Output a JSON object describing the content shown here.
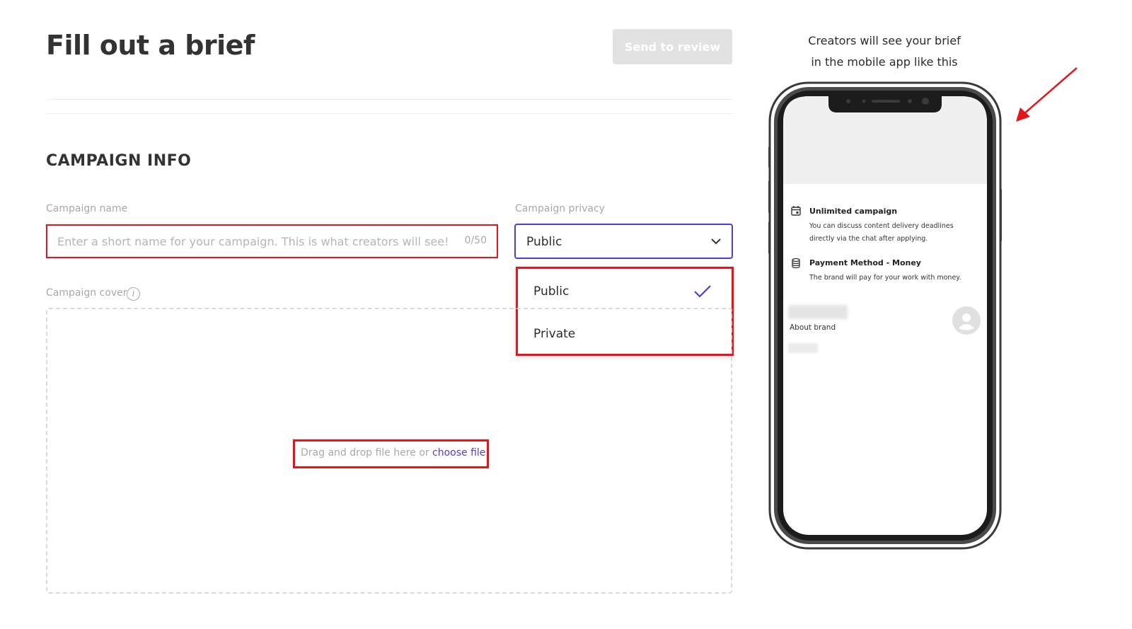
{
  "header": {
    "title": "Fill out a brief",
    "send_button": "Send to review"
  },
  "section": {
    "title": "CAMPAIGN INFO"
  },
  "campaign_name": {
    "label": "Campaign name",
    "placeholder": "Enter a short name for your campaign. This is what creators will see!",
    "value": "",
    "counter": "0/50"
  },
  "campaign_privacy": {
    "label": "Campaign privacy",
    "selected": "Public",
    "options": [
      "Public",
      "Private"
    ]
  },
  "campaign_cover": {
    "label": "Campaign cover",
    "drop_text": "Drag and drop file here or",
    "choose_link": "choose file"
  },
  "preview": {
    "caption_line1": "Creators will see your brief",
    "caption_line2": "in the mobile app like this",
    "unlimited_title": "Unlimited campaign",
    "unlimited_sub1": "You can discuss content delivery deadlines",
    "unlimited_sub2": "directly via the chat after applying.",
    "payment_title": "Payment Method - Money",
    "payment_sub": "The brand will pay for your work with money.",
    "about_brand": "About brand"
  },
  "colors": {
    "accent": "#4b3fd6",
    "highlight": "#e4161b",
    "disabled_button": "#e2e2e2"
  },
  "icons": {
    "chevron": "chevron-down-icon",
    "check": "checkmark-icon",
    "info": "info-icon",
    "calendar": "calendar-icon",
    "coins": "coins-icon",
    "avatar": "user-avatar-icon",
    "arrow": "red-arrow-icon"
  }
}
